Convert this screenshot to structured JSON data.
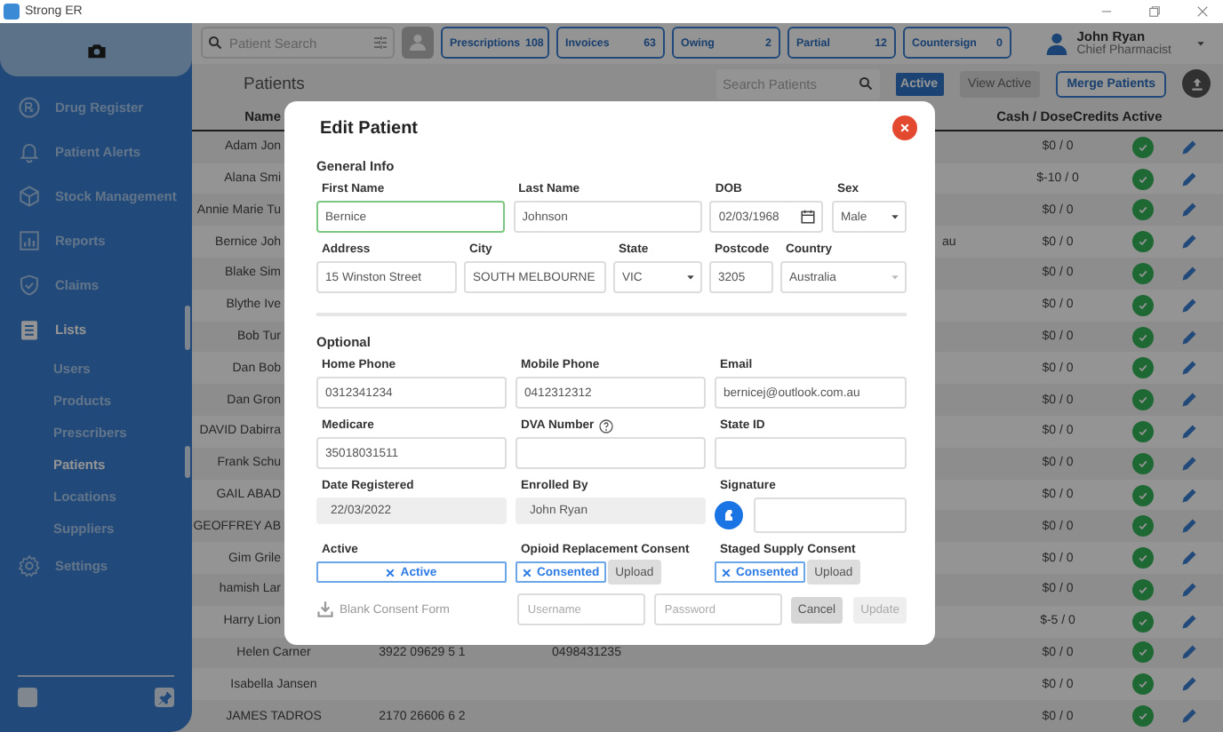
{
  "window": {
    "title": "Strong ER"
  },
  "sidebar": {
    "items": [
      {
        "label": "Drug Register",
        "selected": false
      },
      {
        "label": "Patient Alerts",
        "selected": false
      },
      {
        "label": "Stock Management",
        "selected": false
      },
      {
        "label": "Reports",
        "selected": false
      },
      {
        "label": "Claims",
        "selected": false
      },
      {
        "label": "Lists",
        "selected": true,
        "children": [
          {
            "label": "Users",
            "selected": false
          },
          {
            "label": "Products",
            "selected": false
          },
          {
            "label": "Prescribers",
            "selected": false
          },
          {
            "label": "Patients",
            "selected": true
          },
          {
            "label": "Locations",
            "selected": false
          },
          {
            "label": "Suppliers",
            "selected": false
          }
        ]
      },
      {
        "label": "Settings",
        "selected": false
      }
    ]
  },
  "top_bar": {
    "search": {
      "placeholder": "Patient Search"
    },
    "counters": [
      {
        "label": "Prescriptions",
        "count": "108"
      },
      {
        "label": "Invoices",
        "count": "63"
      },
      {
        "label": "Owing",
        "count": "2"
      },
      {
        "label": "Partial",
        "count": "12"
      },
      {
        "label": "Countersign",
        "count": "0"
      }
    ],
    "user": {
      "name": "John Ryan",
      "role": "Chief Pharmacist"
    }
  },
  "patients": {
    "title": "Patients",
    "search": {
      "placeholder": "Search Patients"
    },
    "filter_badge": "Active",
    "buttons": [
      "View Active",
      "Merge Patients"
    ],
    "columns": [
      "Name",
      "Cash / DoseCredits",
      "Active"
    ],
    "rows": [
      {
        "name": "Adam Jon",
        "cash": "$0 / 0",
        "active": true
      },
      {
        "name": "Alana Smi",
        "cash": "$-10 / 0",
        "active": true
      },
      {
        "name": "Annie Marie Tu",
        "cash": "$0 / 0",
        "active": true
      },
      {
        "name": "Bernice Joh",
        "column_4": "au",
        "cash": "$0 / 0",
        "active": true
      },
      {
        "name": "Blake Sim",
        "cash": "$0 / 0",
        "active": true
      },
      {
        "name": "Blythe Ive",
        "cash": "$0 / 0",
        "active": true
      },
      {
        "name": "Bob Tur",
        "cash": "$0 / 0",
        "active": true
      },
      {
        "name": "Dan Bob",
        "cash": "$0 / 0",
        "active": true
      },
      {
        "name": "Dan Gron",
        "cash": "$0 / 0",
        "active": true
      },
      {
        "name": "DAVID Dabirra",
        "cash": "$0 / 0",
        "active": true
      },
      {
        "name": "Frank Schu",
        "cash": "$0 / 0",
        "active": true
      },
      {
        "name": "GAIL ABAD",
        "cash": "$0 / 0",
        "active": true
      },
      {
        "name": "GEOFFREY AB",
        "cash": "$0 / 0",
        "active": true
      },
      {
        "name": "Gim Grile",
        "cash": "$0 / 0",
        "active": true
      },
      {
        "name": "hamish Lar",
        "cash": "$0 / 0",
        "active": true
      },
      {
        "name": "Harry Lion",
        "cash": "$-5 / 0",
        "active": true
      },
      {
        "name": "Helen Carner",
        "column_2": "3922 09629 5 1",
        "column_3": "0498431235",
        "cash": "$0 / 0",
        "active": true
      },
      {
        "name": "Isabella Jansen",
        "cash": "$0 / 0",
        "active": true
      },
      {
        "name": "JAMES TADROS",
        "column_2": "2170 26606 6 2",
        "cash": "$0 / 0",
        "active": true
      }
    ]
  },
  "modal": {
    "title": "Edit Patient",
    "sections": [
      {
        "title": "General Info",
        "fields": [
          {
            "kind": "text",
            "label": "First Name",
            "value": "Bernice",
            "focused": true
          },
          {
            "kind": "text",
            "label": "Last Name",
            "value": "Johnson",
            "focused": false
          },
          {
            "kind": "date",
            "label": "DOB",
            "value": "02/03/1968",
            "focused": false
          },
          {
            "kind": "select",
            "label": "Sex",
            "value": "Male",
            "focused": false
          },
          {
            "kind": "text",
            "label": "Address",
            "value": "15 Winston Street",
            "focused": false
          },
          {
            "kind": "text",
            "label": "City",
            "value": "SOUTH MELBOURNE",
            "focused": false
          },
          {
            "kind": "select",
            "label": "State",
            "value": "VIC",
            "focused": false
          },
          {
            "kind": "text",
            "label": "Postcode",
            "value": "3205",
            "focused": false
          },
          {
            "kind": "select",
            "label": "Country",
            "value": "Australia",
            "focused": false
          }
        ]
      },
      {
        "title": "Optional",
        "fields": [
          {
            "kind": "text",
            "label": "Home Phone",
            "value": "0312341234",
            "focused": false
          },
          {
            "kind": "text",
            "label": "Mobile Phone",
            "value": "0412312312",
            "focused": false
          },
          {
            "kind": "text",
            "label": "Email",
            "value": "bernicej@outlook.com.au",
            "focused": false
          },
          {
            "kind": "text",
            "label": "Medicare",
            "value": "35018031511",
            "focused": false
          },
          {
            "kind": "text",
            "label": "DVA Number",
            "help": true,
            "focused": false
          },
          {
            "kind": "text",
            "label": "State ID",
            "focused": false
          },
          {
            "kind": "readonly",
            "label": "Date Registered",
            "value": "22/03/2022"
          },
          {
            "kind": "readonly",
            "label": "Enrolled By",
            "value": "John Ryan"
          },
          {
            "kind": "signature",
            "label": "Signature"
          },
          {
            "kind": "toggle",
            "label": "Active",
            "toggle": "Active",
            "on": true
          },
          {
            "kind": "toggle",
            "label": "Opioid Replacement Consent",
            "toggle": "Consented",
            "on": true,
            "upload": "Upload"
          },
          {
            "kind": "toggle",
            "label": "Staged Supply Consent",
            "toggle": "Consented",
            "on": true,
            "upload": "Upload"
          }
        ]
      }
    ],
    "footer": {
      "link": "Blank Consent Form",
      "username": {
        "placeholder": "Username"
      },
      "password": {
        "placeholder": "Password"
      },
      "buttons": [
        {
          "label": "Cancel",
          "disabled": false
        },
        {
          "label": "Update",
          "disabled": true
        }
      ]
    }
  }
}
